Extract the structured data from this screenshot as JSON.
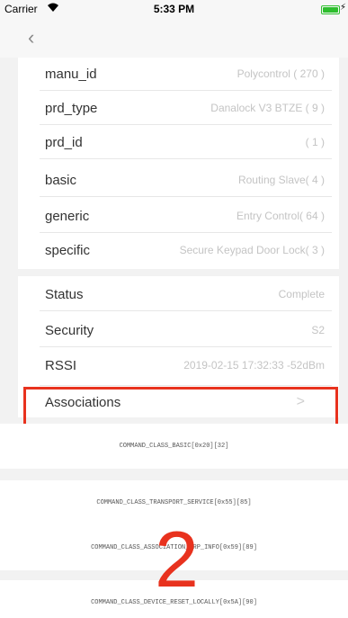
{
  "status_bar": {
    "carrier": "Carrier",
    "wifi_icon": "wifi-icon",
    "time": "5:33 PM",
    "battery_icon": "battery-icon",
    "battery_level": 1.0,
    "charging_icon": "bolt-icon"
  },
  "nav": {
    "back_icon": "chevron-left-icon",
    "back_glyph": "‹"
  },
  "info": [
    {
      "label": "manu_id",
      "value": "Polycontrol ( 270 )"
    },
    {
      "label": "prd_type",
      "value": "Danalock V3 BTZE ( 9 )"
    },
    {
      "label": "prd_id",
      "value": "( 1 )"
    },
    {
      "label": "basic",
      "value": "Routing Slave( 4 )"
    },
    {
      "label": "generic",
      "value": "Entry Control( 64 )"
    },
    {
      "label": "specific",
      "value": "Secure Keypad Door Lock( 3 )"
    }
  ],
  "details": [
    {
      "label": "Status",
      "value": "Complete"
    },
    {
      "label": "Security",
      "value": "S2"
    },
    {
      "label": "RSSI",
      "value": "2019-02-15 17:32:33 -52dBm"
    }
  ],
  "associations": {
    "label": "Associations",
    "chevron_glyph": ">",
    "chevron_icon": "chevron-right-icon"
  },
  "command_classes": [
    "COMMAND_CLASS_BASIC[0x20][32]",
    "COMMAND_CLASS_TRANSPORT_SERVICE[0x55][85]",
    "COMMAND_CLASS_ASSOCIATION_GRP_INFO[0x59][89]",
    "COMMAND_CLASS_DEVICE_RESET_LOCALLY[0x5A][90]"
  ],
  "annotation": {
    "number": "2",
    "color": "#e8321e"
  }
}
